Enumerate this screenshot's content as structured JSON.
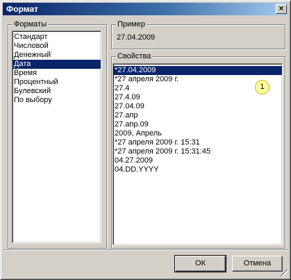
{
  "window": {
    "title": "Формат",
    "close_glyph": "×"
  },
  "formats": {
    "label": "Форматы",
    "items": [
      {
        "label": "Стандарт"
      },
      {
        "label": "Числовой"
      },
      {
        "label": "Денежный"
      },
      {
        "label": "Дата"
      },
      {
        "label": "Время"
      },
      {
        "label": "Процентный"
      },
      {
        "label": "Булевский"
      },
      {
        "label": "По выбору"
      }
    ],
    "selected": "Дата"
  },
  "example": {
    "label": "Пример",
    "value": "27.04.2009"
  },
  "properties": {
    "label": "Свойства",
    "items": [
      {
        "label": "*27.04.2009"
      },
      {
        "label": "*27 апреля 2009 г."
      },
      {
        "label": "27.4"
      },
      {
        "label": "27.4.09"
      },
      {
        "label": "27.04.09"
      },
      {
        "label": "27.апр"
      },
      {
        "label": "27.апр.09"
      },
      {
        "label": "2009, Апрель"
      },
      {
        "label": "*27 апреля 2009 г. 15:31"
      },
      {
        "label": "*27 апреля 2009 г. 15:31:45"
      },
      {
        "label": "04.27.2009"
      },
      {
        "label": "04.DD.YYYY"
      }
    ],
    "selected": "*27.04.2009",
    "marker": "1"
  },
  "buttons": {
    "ok": "ОК",
    "cancel": "Отмена"
  },
  "colors": {
    "selection": "#0a246a",
    "face": "#d4d0c8",
    "marker_fill": "#ffffa0"
  }
}
